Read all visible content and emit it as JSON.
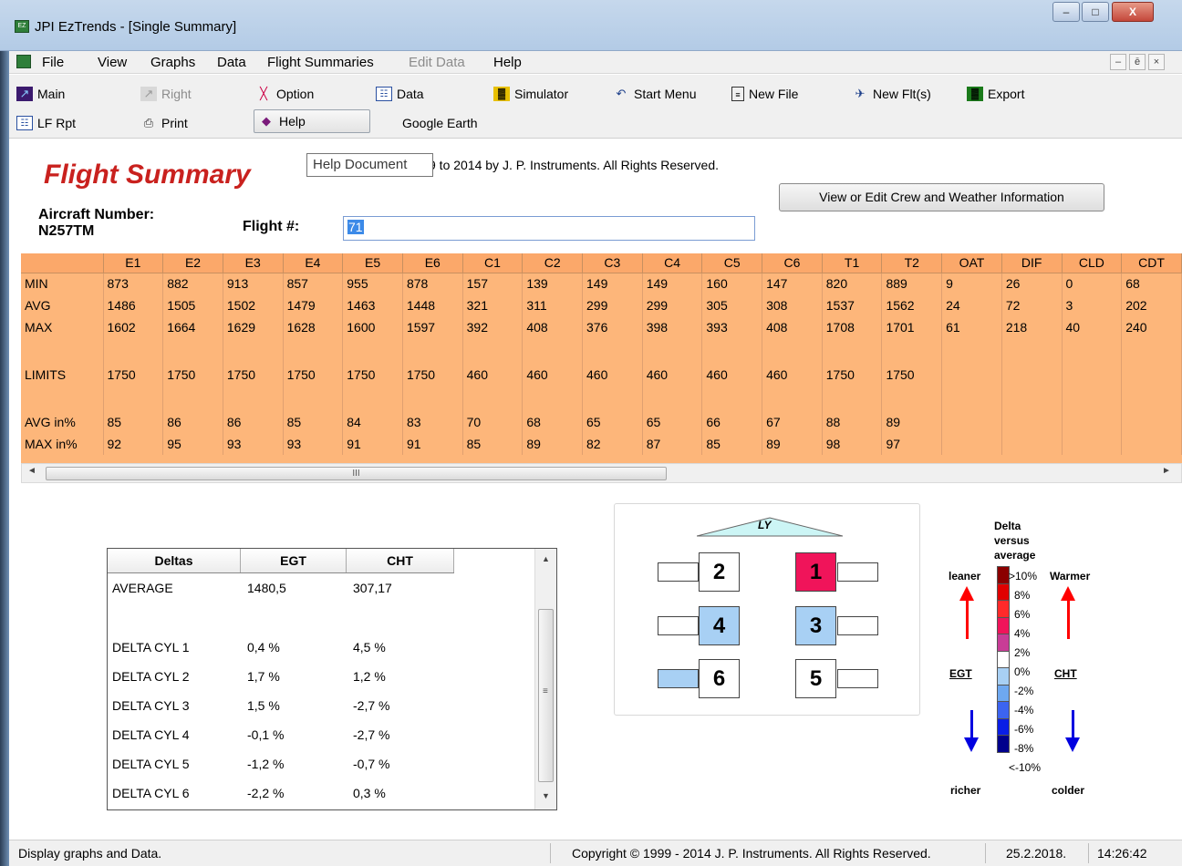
{
  "window": {
    "title": "JPI EzTrends - [Single Summary]",
    "minimize": "–",
    "maximize": "□",
    "close": "X"
  },
  "menu": {
    "items": [
      "File",
      "View",
      "Graphs",
      "Data",
      "Flight Summaries",
      "Edit Data",
      "Help"
    ],
    "disabled": [
      "Edit Data"
    ],
    "mdi_min": "–",
    "mdi_restore": "ē",
    "mdi_close": "×"
  },
  "toolbar": {
    "main": "Main",
    "right": "Right",
    "option": "Option",
    "data": "Data",
    "simulator": "Simulator",
    "start_menu": "Start Menu",
    "new_file": "New File",
    "new_flts": "New Flt(s)",
    "export": "Export",
    "lf_rpt": "LF Rpt",
    "print": "Print",
    "help": "Help",
    "google_earth": "Google Earth"
  },
  "tooltip": "Help Document",
  "header": {
    "title": "Flight Summary",
    "copyright": "9 to 2014 by J. P. Instruments. All Rights Reserved.",
    "view_button": "View or Edit Crew and Weather Information",
    "aircraft_label": "Aircraft Number:",
    "aircraft_value": "N257TM",
    "flight_label": "Flight #:",
    "flight_value": "71"
  },
  "grid": {
    "columns": [
      "E1",
      "E2",
      "E3",
      "E4",
      "E5",
      "E6",
      "C1",
      "C2",
      "C3",
      "C4",
      "C5",
      "C6",
      "T1",
      "T2",
      "OAT",
      "DIF",
      "CLD",
      "CDT"
    ],
    "rows": [
      {
        "label": "MIN",
        "values": [
          "873",
          "882",
          "913",
          "857",
          "955",
          "878",
          "157",
          "139",
          "149",
          "149",
          "160",
          "147",
          "820",
          "889",
          "9",
          "26",
          "0",
          "68"
        ]
      },
      {
        "label": "AVG",
        "values": [
          "1486",
          "1505",
          "1502",
          "1479",
          "1463",
          "1448",
          "321",
          "311",
          "299",
          "299",
          "305",
          "308",
          "1537",
          "1562",
          "24",
          "72",
          "3",
          "202"
        ]
      },
      {
        "label": "MAX",
        "values": [
          "1602",
          "1664",
          "1629",
          "1628",
          "1600",
          "1597",
          "392",
          "408",
          "376",
          "398",
          "393",
          "408",
          "1708",
          "1701",
          "61",
          "218",
          "40",
          "240"
        ]
      },
      {
        "label": "",
        "values": [
          "",
          "",
          "",
          "",
          "",
          "",
          "",
          "",
          "",
          "",
          "",
          "",
          "",
          "",
          "",
          "",
          "",
          ""
        ]
      },
      {
        "label": "LIMITS",
        "values": [
          "1750",
          "1750",
          "1750",
          "1750",
          "1750",
          "1750",
          "460",
          "460",
          "460",
          "460",
          "460",
          "460",
          "1750",
          "1750",
          "",
          "",
          "",
          ""
        ]
      },
      {
        "label": "",
        "values": [
          "",
          "",
          "",
          "",
          "",
          "",
          "",
          "",
          "",
          "",
          "",
          "",
          "",
          "",
          "",
          "",
          "",
          ""
        ]
      },
      {
        "label": "AVG in%",
        "values": [
          "85",
          "86",
          "86",
          "85",
          "84",
          "83",
          "70",
          "68",
          "65",
          "65",
          "66",
          "67",
          "88",
          "89",
          "",
          "",
          "",
          ""
        ]
      },
      {
        "label": "MAX in%",
        "values": [
          "92",
          "95",
          "93",
          "93",
          "91",
          "91",
          "85",
          "89",
          "82",
          "87",
          "85",
          "89",
          "98",
          "97",
          "",
          "",
          "",
          ""
        ]
      }
    ]
  },
  "scroll": {
    "thumb_grip": "III",
    "left": "◄",
    "right": "►",
    "up": "▲",
    "down": "▼",
    "grip": "≡"
  },
  "deltas": {
    "headers": [
      "Deltas",
      "EGT",
      "CHT"
    ],
    "rows": [
      [
        "AVERAGE",
        "1480,5",
        "307,17"
      ],
      [
        "DELTA CYL 1",
        "0,4 %",
        "4,5 %"
      ],
      [
        "DELTA CYL 2",
        "1,7 %",
        "1,2 %"
      ],
      [
        "DELTA CYL 3",
        "1,5 %",
        "-2,7 %"
      ],
      [
        "DELTA CYL 4",
        "-0,1 %",
        "-2,7 %"
      ],
      [
        "DELTA CYL 5",
        "-1,2 %",
        "-0,7 %"
      ],
      [
        "DELTA CYL 6",
        "-2,2 %",
        "0,3 %"
      ]
    ]
  },
  "engine": {
    "ly_label": "LY",
    "cylinders": [
      {
        "num": "2",
        "color": "#ffffff",
        "egt_color": "#ffffff"
      },
      {
        "num": "1",
        "color": "#f0145a",
        "egt_color": "#ffffff"
      },
      {
        "num": "4",
        "color": "#a8d0f4",
        "egt_color": "#ffffff"
      },
      {
        "num": "3",
        "color": "#a8d0f4",
        "egt_color": "#ffffff"
      },
      {
        "num": "6",
        "color": "#ffffff",
        "egt_color": "#a8d0f4"
      },
      {
        "num": "5",
        "color": "#ffffff",
        "egt_color": "#ffffff"
      }
    ]
  },
  "legend": {
    "title": [
      "Delta",
      "versus",
      "average"
    ],
    "levels": [
      ">10%",
      "8%",
      "6%",
      "4%",
      "2%",
      "0%",
      "-2%",
      "-4%",
      "-6%",
      "-8%",
      "<-10%"
    ],
    "colors": [
      "#8b0000",
      "#e00000",
      "#ff2a2a",
      "#f0145a",
      "#c83c96",
      "#ffffff",
      "#a8d0f4",
      "#6ea8f0",
      "#3c64f0",
      "#0a1ee6",
      "#00008c"
    ],
    "leaner": "leaner",
    "warmer": "Warmer",
    "egt": "EGT",
    "cht": "CHT",
    "richer": "richer",
    "colder": "colder"
  },
  "status": {
    "hint": "Display graphs and Data.",
    "copyright": "Copyright © 1999 - 2014 J. P. Instruments. All Rights Reserved.",
    "date": "25.2.2018.",
    "time": "14:26:42"
  }
}
